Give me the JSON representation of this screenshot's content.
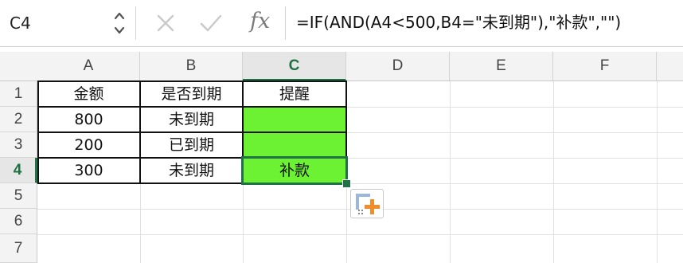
{
  "formula_bar": {
    "name_box": "C4",
    "fx_label": "fx",
    "formula": "=IF(AND(A4<500,B4=\"未到期\"),\"补款\",\"\")"
  },
  "columns": [
    "A",
    "B",
    "C",
    "D",
    "E",
    "F"
  ],
  "rows": [
    "1",
    "2",
    "3",
    "4",
    "5",
    "6",
    "7"
  ],
  "cells": {
    "A1": "金额",
    "B1": "是否到期",
    "C1": "提醒",
    "A2": "800",
    "B2": "未到期",
    "C2": "",
    "A3": "200",
    "B3": "已到期",
    "C3": "",
    "A4": "300",
    "B4": "未到期",
    "C4": "补款"
  },
  "selected_cell": "C4",
  "colors": {
    "highlight_fill": "#6cf233",
    "selection_accent": "#1f7245",
    "paste_icon_accent": "#f08c2a"
  }
}
